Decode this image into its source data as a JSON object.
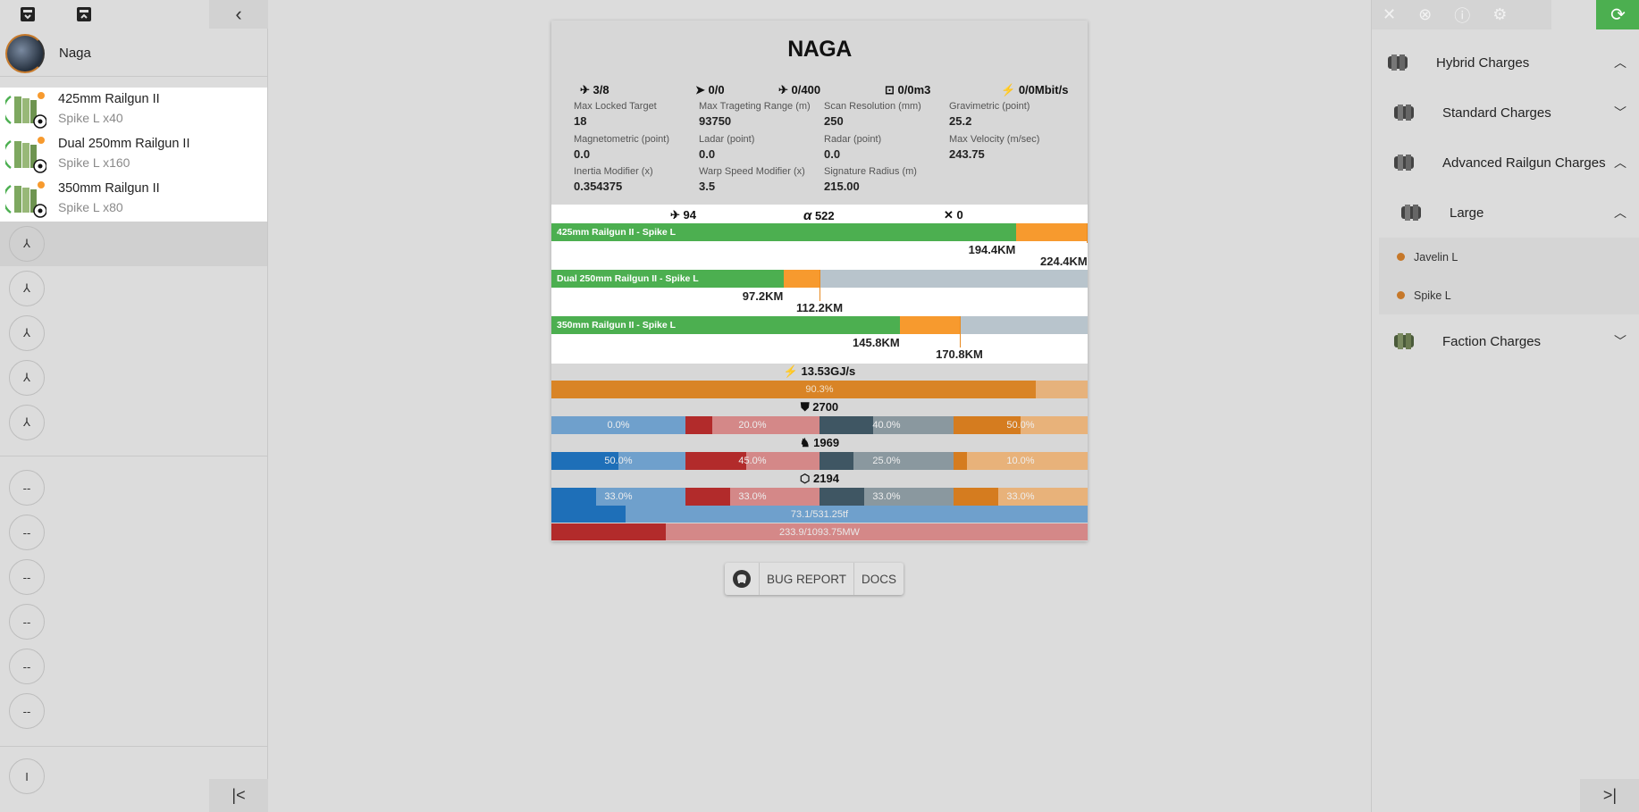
{
  "left": {
    "top_icons": [
      "save-icon",
      "load-icon"
    ],
    "back_icon": "‹",
    "ship": {
      "name": "Naga"
    },
    "modules": [
      {
        "title": "425mm Railgun II",
        "charge": "Spike L x40"
      },
      {
        "title": "Dual 250mm Railgun II",
        "charge": "Spike L x160"
      },
      {
        "title": "350mm Railgun II",
        "charge": "Spike L x80"
      }
    ],
    "mid_slot_glyph": "⅄",
    "low_slot_glyph": "--",
    "rig_slot_glyph": "I",
    "collapse_icon": "|<"
  },
  "right": {
    "top_icons": [
      "close-icon",
      "cancel-icon",
      "info-icon",
      "settings-icon"
    ],
    "sync_icon": "⟳",
    "groups": {
      "hybrid": "Hybrid Charges",
      "standard": "Standard Charges",
      "advanced": "Advanced Railgun Charges",
      "large": "Large",
      "faction": "Faction Charges"
    },
    "leaves": [
      "Javelin L",
      "Spike L"
    ],
    "expand_icon": ">|",
    "accent": "#4caf50",
    "leaf_dot_color": "#c6782a"
  },
  "card": {
    "title": "NAGA",
    "caps": {
      "launchers": "3/8",
      "drones": "0/0",
      "drone_bay": "0/400",
      "drone_bandwidth": "0/0m3",
      "bandwidth_mbit": "0/0Mbit/s"
    },
    "stats": [
      {
        "label": "Max Locked Target",
        "value": "18"
      },
      {
        "label": "Max Trageting Range (m)",
        "value": "93750"
      },
      {
        "label": "Scan Resolution (mm)",
        "value": "250"
      },
      {
        "label": "Gravimetric (point)",
        "value": "25.2"
      },
      {
        "label": "Magnetometric (point)",
        "value": "0.0"
      },
      {
        "label": "Ladar (point)",
        "value": "0.0"
      },
      {
        "label": "Radar (point)",
        "value": "0.0"
      },
      {
        "label": "Max Velocity (m/sec)",
        "value": "243.75"
      },
      {
        "label": "Inertia Modifier (x)",
        "value": "0.354375"
      },
      {
        "label": "Warp Speed Modifier (x)",
        "value": "3.5"
      },
      {
        "label": "Signature Radius (m)",
        "value": "215.00"
      }
    ],
    "dps": {
      "total": "94",
      "alpha": "522",
      "drone": "0"
    },
    "weapons": [
      {
        "label": "425mm Railgun II - Spike L",
        "optimal": "194.4KM",
        "falloff": "224.4KM",
        "optimal_frac": 0.866,
        "falloff_frac": 1.0
      },
      {
        "label": "Dual 250mm Railgun II - Spike L",
        "optimal": "97.2KM",
        "falloff": "112.2KM",
        "optimal_frac": 0.433,
        "falloff_frac": 0.5
      },
      {
        "label": "350mm Railgun II - Spike L",
        "optimal": "145.8KM",
        "falloff": "170.8KM",
        "optimal_frac": 0.65,
        "falloff_frac": 0.761
      }
    ],
    "capacitor": {
      "rate": "13.53GJ/s",
      "percent": "90.3%",
      "fill": 0.903
    },
    "shield": {
      "hp": "2700",
      "resists": [
        "0.0%",
        "20.0%",
        "40.0%",
        "50.0%"
      ],
      "fills": [
        0.0,
        0.2,
        0.4,
        0.5
      ]
    },
    "armor": {
      "hp": "1969",
      "resists": [
        "50.0%",
        "45.0%",
        "25.0%",
        "10.0%"
      ],
      "fills": [
        0.5,
        0.45,
        0.25,
        0.1
      ]
    },
    "hull": {
      "hp": "2194",
      "resists": [
        "33.0%",
        "33.0%",
        "33.0%",
        "33.0%"
      ],
      "fills": [
        0.33,
        0.33,
        0.33,
        0.33
      ]
    },
    "cpu": {
      "text": "73.1/531.25tf",
      "fill": 0.138
    },
    "power": {
      "text": "233.9/1093.75MW",
      "fill": 0.214
    },
    "resist_colors": {
      "em": [
        "#1e6fb8",
        "#6fa0cc"
      ],
      "thermal": [
        "#b22b2b",
        "#d48888"
      ],
      "kinetic": [
        "#3f5663",
        "#8a989f"
      ],
      "explosive": [
        "#d57c1f",
        "#e8b27a"
      ]
    }
  },
  "footer": {
    "github_icon": "github-icon",
    "bug": "BUG REPORT",
    "docs": "DOCS"
  }
}
